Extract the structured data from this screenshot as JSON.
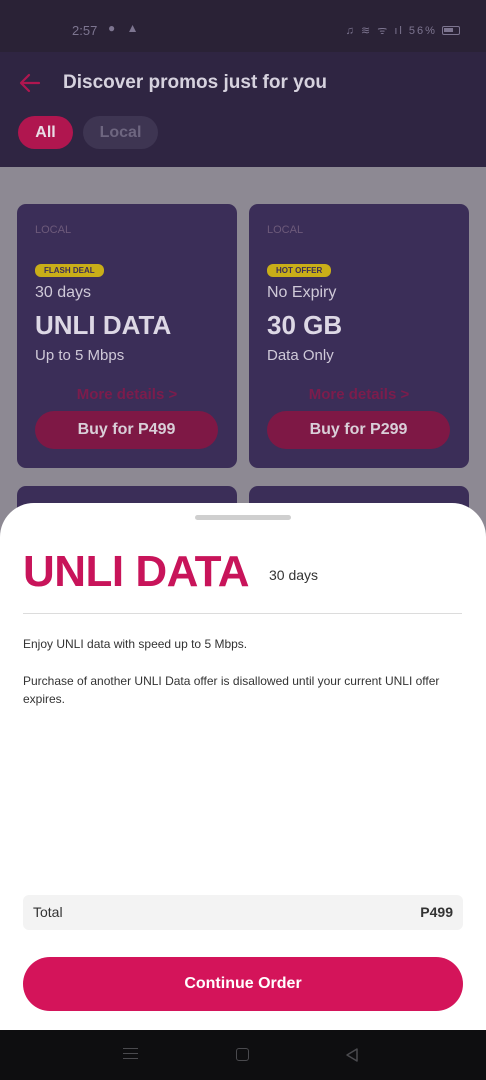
{
  "status_bar": {
    "time": "2:57",
    "left_icons": "● ▲",
    "right_text": "♫ ≋ ᯤ ıl 56%"
  },
  "header": {
    "title": "Discover promos just for you",
    "back_icon": "arrow-left-icon"
  },
  "filters": [
    {
      "label": "All",
      "selected": true
    },
    {
      "label": "Local",
      "selected": false
    }
  ],
  "promos": [
    {
      "tag": "LOCAL",
      "badge": "FLASH DEAL",
      "period": "30 days",
      "name": "UNLI DATA",
      "sub": "Up to 5 Mbps",
      "more": "More details >",
      "buy": "Buy for P499"
    },
    {
      "tag": "LOCAL",
      "badge": "HOT OFFER",
      "period": "No Expiry",
      "name": "30 GB",
      "sub": "Data Only",
      "more": "More details >",
      "buy": "Buy for P299"
    }
  ],
  "sheet": {
    "title": "UNLI DATA",
    "duration": "30 days",
    "description_1": "Enjoy UNLI data with speed up to 5 Mbps.",
    "description_2": "Purchase of another UNLI Data offer is disallowed until your current UNLI offer expires.",
    "total_label": "Total",
    "total_value": "P499",
    "continue_label": "Continue Order"
  },
  "colors": {
    "accent": "#d4145a",
    "card_bg": "#3b2e58",
    "header_bg": "#2f2542",
    "badge": "#c9ae18"
  }
}
